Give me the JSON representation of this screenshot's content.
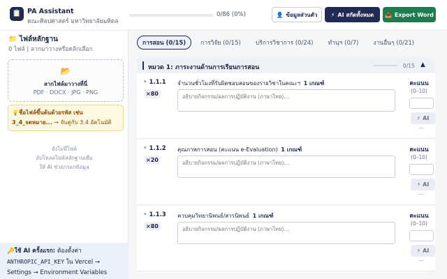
{
  "header": {
    "logo_icon": "clipboard-icon",
    "title": "PA Assistant",
    "subtitle": "คณะศิลปศาสตร์ มหาวิทยาลัยมหิดล",
    "progress_text": "0/86 (0%)",
    "progress_fraction": 0,
    "personal_button": "ข้อมูลส่วนตัว",
    "ai_all_button": "AI สกัดทั้งหมด",
    "export_button": "Export Word"
  },
  "sidebar": {
    "title": "ไฟล์หลักฐาน",
    "subtitle": "0 ไฟล์ | ลากมาวางหรือคลิกเลือก",
    "dropzone_label": "ลากไฟล์มาวางที่นี่",
    "dropzone_formats": "PDF · DOCX · JPG · PNG",
    "tip_line1": "ชื่อไฟล์ขึ้นต้นด้วยรหัส เช่น",
    "tip_code": "3_4_จดหมาย...",
    "tip_line2": "→ จับคู่กับ 3.4 อัตโนมัติ",
    "empty_line1": "ยังไม่มีไฟล์",
    "empty_line2": "อัปโหลดไฟล์หลักฐานเพื่อ",
    "empty_line3": "ให้ AI ช่วยกรอกข้อมูล",
    "api_prefix": "ใช้ AI ครั้งแรก:",
    "api_text": "ต้องตั้งค่า",
    "api_key": "ANTHROPIC_API_KEY",
    "api_in": "ใน Vercel →",
    "api_path": "Settings → Environment Variables"
  },
  "tabs": [
    {
      "label": "การสอน (0/15)",
      "active": true
    },
    {
      "label": "การวิจัย (0/15)",
      "active": false
    },
    {
      "label": "บริการวิชาการ (0/24)",
      "active": false
    },
    {
      "label": "ทำนุฯ (0/7)",
      "active": false
    },
    {
      "label": "งานอื่นๆ (0/21)",
      "active": false
    }
  ],
  "section": {
    "title": "หมวด 1: ภาระงานด้านการเรียนการสอน",
    "count": "0/15",
    "toggle": "▲"
  },
  "items": [
    {
      "code": "1.1.1",
      "multiplier": "×80",
      "title": "จำนวนชั่วโมงที่รับผิดชอบสอนของรายวิชาในคณะฯ",
      "criteria": "1 เกณฑ์",
      "placeholder": "อธิบายกิจกรรม/ผลการปฏิบัติงาน (ภาษาไทย)...",
      "score_label": "คะแนน",
      "score_range": "(0–10)",
      "ai_label": "⚡ AI",
      "ai_status": "—"
    },
    {
      "code": "1.1.2",
      "multiplier": "×20",
      "title": "คุณภาพการสอน (คะแนน e-Evaluation)",
      "criteria": "1 เกณฑ์",
      "placeholder": "อธิบายกิจกรรม/ผลการปฏิบัติงาน (ภาษาไทย)...",
      "score_label": "คะแนน",
      "score_range": "(0–10)",
      "ai_label": "⚡ AI",
      "ai_status": "—"
    },
    {
      "code": "1.1.3",
      "multiplier": "×80",
      "title": "ควบคุมวิทยานิพนธ์/สารนิพนธ์",
      "criteria": "1 เกณฑ์",
      "placeholder": "อธิบายกิจกรรม/ผลการปฏิบัติงาน (ภาษาไทย)...",
      "score_label": "คะแนน",
      "score_range": "(0–10)",
      "ai_label": "⚡ AI",
      "ai_status": "—"
    }
  ]
}
